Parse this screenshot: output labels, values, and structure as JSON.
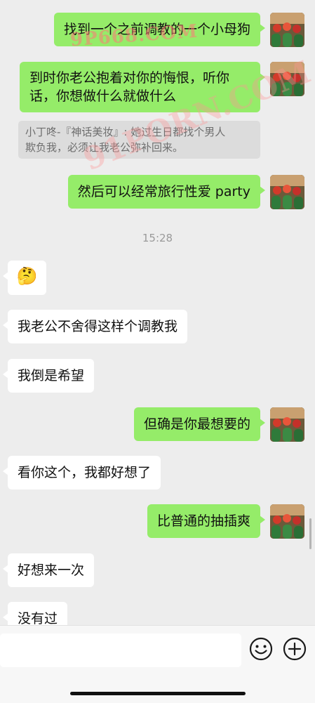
{
  "messages": {
    "m1": "找到一个之前调教的一个小母狗",
    "m2_line1": "到时你老公抱着对你的悔恨，听你",
    "m2_line2": "话，你想做什么就做什么",
    "quote_line1": "小丁咚-『神话美妆』: 她过生日都找个男人",
    "quote_line2": "欺负我，必须让我老公弥补回来。",
    "m3": "然后可以经常旅行性爱 party",
    "timestamp": "15:28",
    "m4_emoji": "🤔",
    "m5": "我老公不舍得这样个调教我",
    "m6": "我倒是希望",
    "m7": "但确是你最想要的",
    "m8": "看你这个，我都好想了",
    "m9": "比普通的抽插爽",
    "m10": "好想来一次",
    "m11": "没有过"
  },
  "watermarks": {
    "w1": "9P668.COM",
    "w2": "91PORN.COM"
  },
  "input_bar": {
    "emoji_icon": "smiley-icon",
    "plus_icon": "plus-icon"
  },
  "colors": {
    "outgoing": "#95ec69",
    "incoming": "#ffffff",
    "background": "#ededed"
  }
}
